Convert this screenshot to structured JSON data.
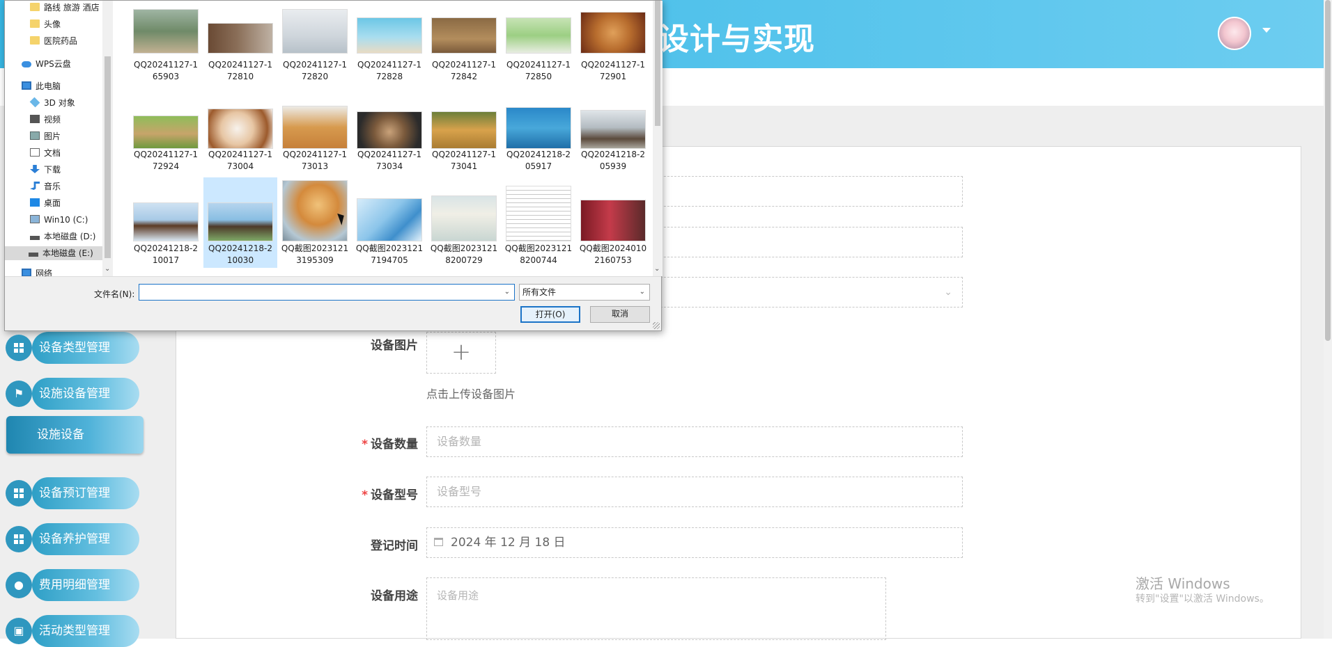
{
  "app": {
    "title": "设计与实现",
    "colors": {
      "header": "#37b6e3",
      "menu": "#2f97bf",
      "required": "#e44444"
    }
  },
  "sidebar": {
    "items": [
      {
        "label": "设备类型管理",
        "icon": "grid-icon"
      },
      {
        "label": "设施设备管理",
        "icon": "flag-icon"
      },
      {
        "label": "设备预订管理",
        "icon": "grid-icon"
      },
      {
        "label": "设备养护管理",
        "icon": "grid-icon"
      },
      {
        "label": "费用明细管理",
        "icon": "user-icon"
      },
      {
        "label": "活动类型管理",
        "icon": "briefcase-icon"
      }
    ],
    "active_sub": "设施设备"
  },
  "form": {
    "image_label": "设备图片",
    "upload_tip": "点击上传设备图片",
    "quantity_label": "设备数量",
    "quantity_placeholder": "设备数量",
    "model_label": "设备型号",
    "model_placeholder": "设备型号",
    "date_label": "登记时间",
    "date_value": "2024 年 12 月 18 日",
    "usage_label": "设备用途",
    "usage_placeholder": "设备用途",
    "required_mark": "*"
  },
  "watermark": {
    "line1": "激活 Windows",
    "line2": "转到\"设置\"以激活 Windows。"
  },
  "dialog": {
    "tree": [
      {
        "label": "路线 旅游 酒店",
        "icon": "folder-icon"
      },
      {
        "label": "头像",
        "icon": "folder-icon"
      },
      {
        "label": "医院药品",
        "icon": "folder-icon"
      },
      {
        "label": "WPS云盘",
        "icon": "cloud-icon"
      },
      {
        "label": "此电脑",
        "icon": "pc-icon"
      },
      {
        "label": "3D 对象",
        "icon": "cube-icon"
      },
      {
        "label": "视频",
        "icon": "video-icon"
      },
      {
        "label": "图片",
        "icon": "picture-icon"
      },
      {
        "label": "文档",
        "icon": "document-icon"
      },
      {
        "label": "下载",
        "icon": "download-icon"
      },
      {
        "label": "音乐",
        "icon": "music-icon"
      },
      {
        "label": "桌面",
        "icon": "desktop-icon"
      },
      {
        "label": "Win10 (C:)",
        "icon": "drive-icon"
      },
      {
        "label": "本地磁盘 (D:)",
        "icon": "drive-icon"
      },
      {
        "label": "本地磁盘 (E:)",
        "icon": "drive-icon"
      },
      {
        "label": "网络",
        "icon": "network-icon"
      }
    ],
    "files": [
      {
        "name": "QQ20241127-165903",
        "thumb": "horse-rider"
      },
      {
        "name": "QQ20241127-172810",
        "thumb": "dog-cat"
      },
      {
        "name": "QQ20241127-172820",
        "thumb": "cat-device"
      },
      {
        "name": "QQ20241127-172828",
        "thumb": "chinchilla"
      },
      {
        "name": "QQ20241127-172842",
        "thumb": "mouse"
      },
      {
        "name": "QQ20241127-172850",
        "thumb": "pet-carrier"
      },
      {
        "name": "QQ20241127-172901",
        "thumb": "hamster"
      },
      {
        "name": "QQ20241127-172924",
        "thumb": "cat-grass"
      },
      {
        "name": "QQ20241127-173004",
        "thumb": "puppy"
      },
      {
        "name": "QQ20241127-173013",
        "thumb": "golden-dog"
      },
      {
        "name": "QQ20241127-173034",
        "thumb": "pug"
      },
      {
        "name": "QQ20241127-173041",
        "thumb": "dog-field"
      },
      {
        "name": "QQ20241218-205917",
        "thumb": "event-banner"
      },
      {
        "name": "QQ20241218-205939",
        "thumb": "horse-riders"
      },
      {
        "name": "QQ20241218-210017",
        "thumb": "horse-jump"
      },
      {
        "name": "QQ20241218-210030",
        "thumb": "horse-child"
      },
      {
        "name": "QQ截图20231213195309",
        "thumb": "cat-closeup"
      },
      {
        "name": "QQ截图20231217194705",
        "thumb": "vaccine"
      },
      {
        "name": "QQ截图20231218200729",
        "thumb": "certificate"
      },
      {
        "name": "QQ截图20231218200744",
        "thumb": "document-scan"
      },
      {
        "name": "QQ截图20240102160753",
        "thumb": "vet-room"
      }
    ],
    "filename_label": "文件名(N):",
    "filename_value": "",
    "filter_value": "所有文件",
    "open_label": "打开(O)",
    "cancel_label": "取消",
    "caret": "⌄"
  }
}
